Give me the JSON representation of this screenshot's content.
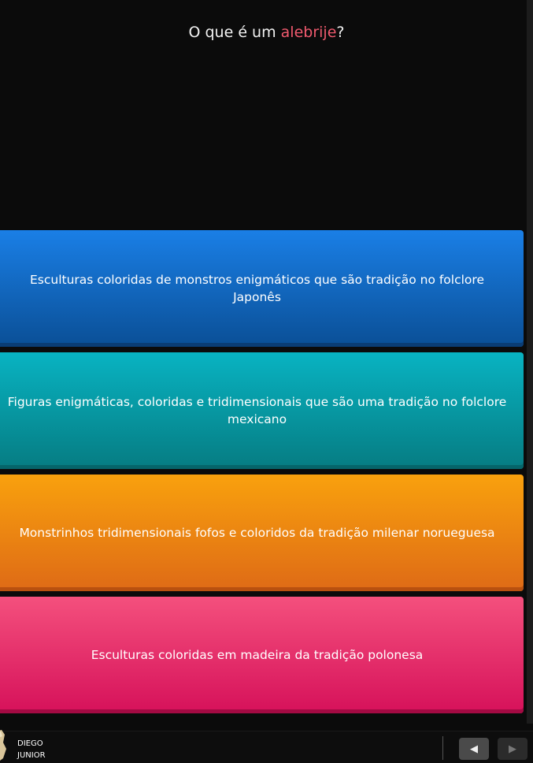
{
  "question": {
    "prefix": "O que é um ",
    "keyword": "alebrije",
    "suffix": "?"
  },
  "answers": [
    {
      "text": "Esculturas coloridas de monstros enigmáticos que são tradição no folclore Japonês",
      "color": "#1a7fe6"
    },
    {
      "text": "Figuras enigmáticas, coloridas e tridimensionais que são uma tradição no folclore mexicano",
      "color": "#08b3c2"
    },
    {
      "text": "Monstrinhos tridimensionais fofos e coloridos da tradição milenar norueguesa",
      "color": "#f9a10d"
    },
    {
      "text": "Esculturas coloridas em madeira da tradição polonesa",
      "color": "#f4507d"
    }
  ],
  "footer": {
    "player_first": "DIEGO",
    "player_last": "JUNIOR",
    "prev_icon": "arrow-left-icon",
    "next_icon": "arrow-right-icon"
  },
  "colors": {
    "background": "#0b0b0b",
    "keyword": "#f05a6e"
  }
}
